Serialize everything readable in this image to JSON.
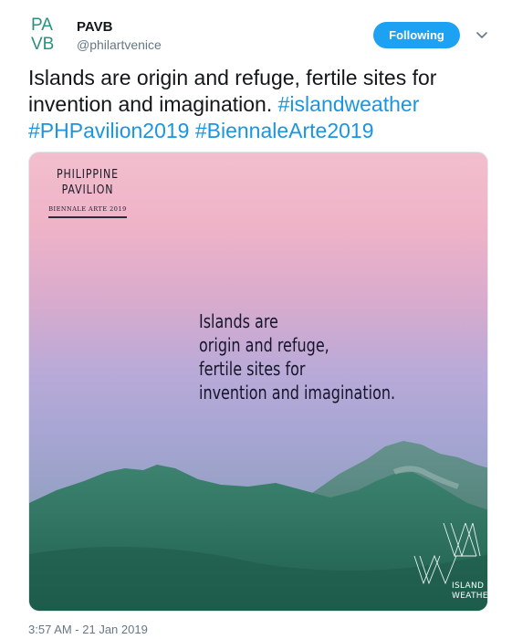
{
  "account": {
    "name": "PAVB",
    "handle": "@philartvenice",
    "avatar_letters": [
      "PA",
      "VB"
    ]
  },
  "follow_button": {
    "label": "Following",
    "color": "#1da1f2"
  },
  "caret_icon": "chevron-down-icon",
  "tweet": {
    "text_plain": "Islands are origin and refuge, fertile sites for invention and imagination. ",
    "hashtags": [
      "#islandweather",
      "#PHPavilion2019",
      "#BiennaleArte2019"
    ],
    "hashtag_color": "#1b95e0"
  },
  "media": {
    "logo": {
      "line1": "PHILIPPINE",
      "line2": "PAVILION",
      "line3": "BIENNALE ARTE 2019"
    },
    "quote_lines": [
      "Islands are",
      "origin and refuge,",
      "fertile sites for",
      "invention and imagination."
    ],
    "island_weather": {
      "line1": "ISLAND",
      "line2": "WEATHER"
    }
  },
  "timestamp": "3:57 AM - 21 Jan 2019"
}
